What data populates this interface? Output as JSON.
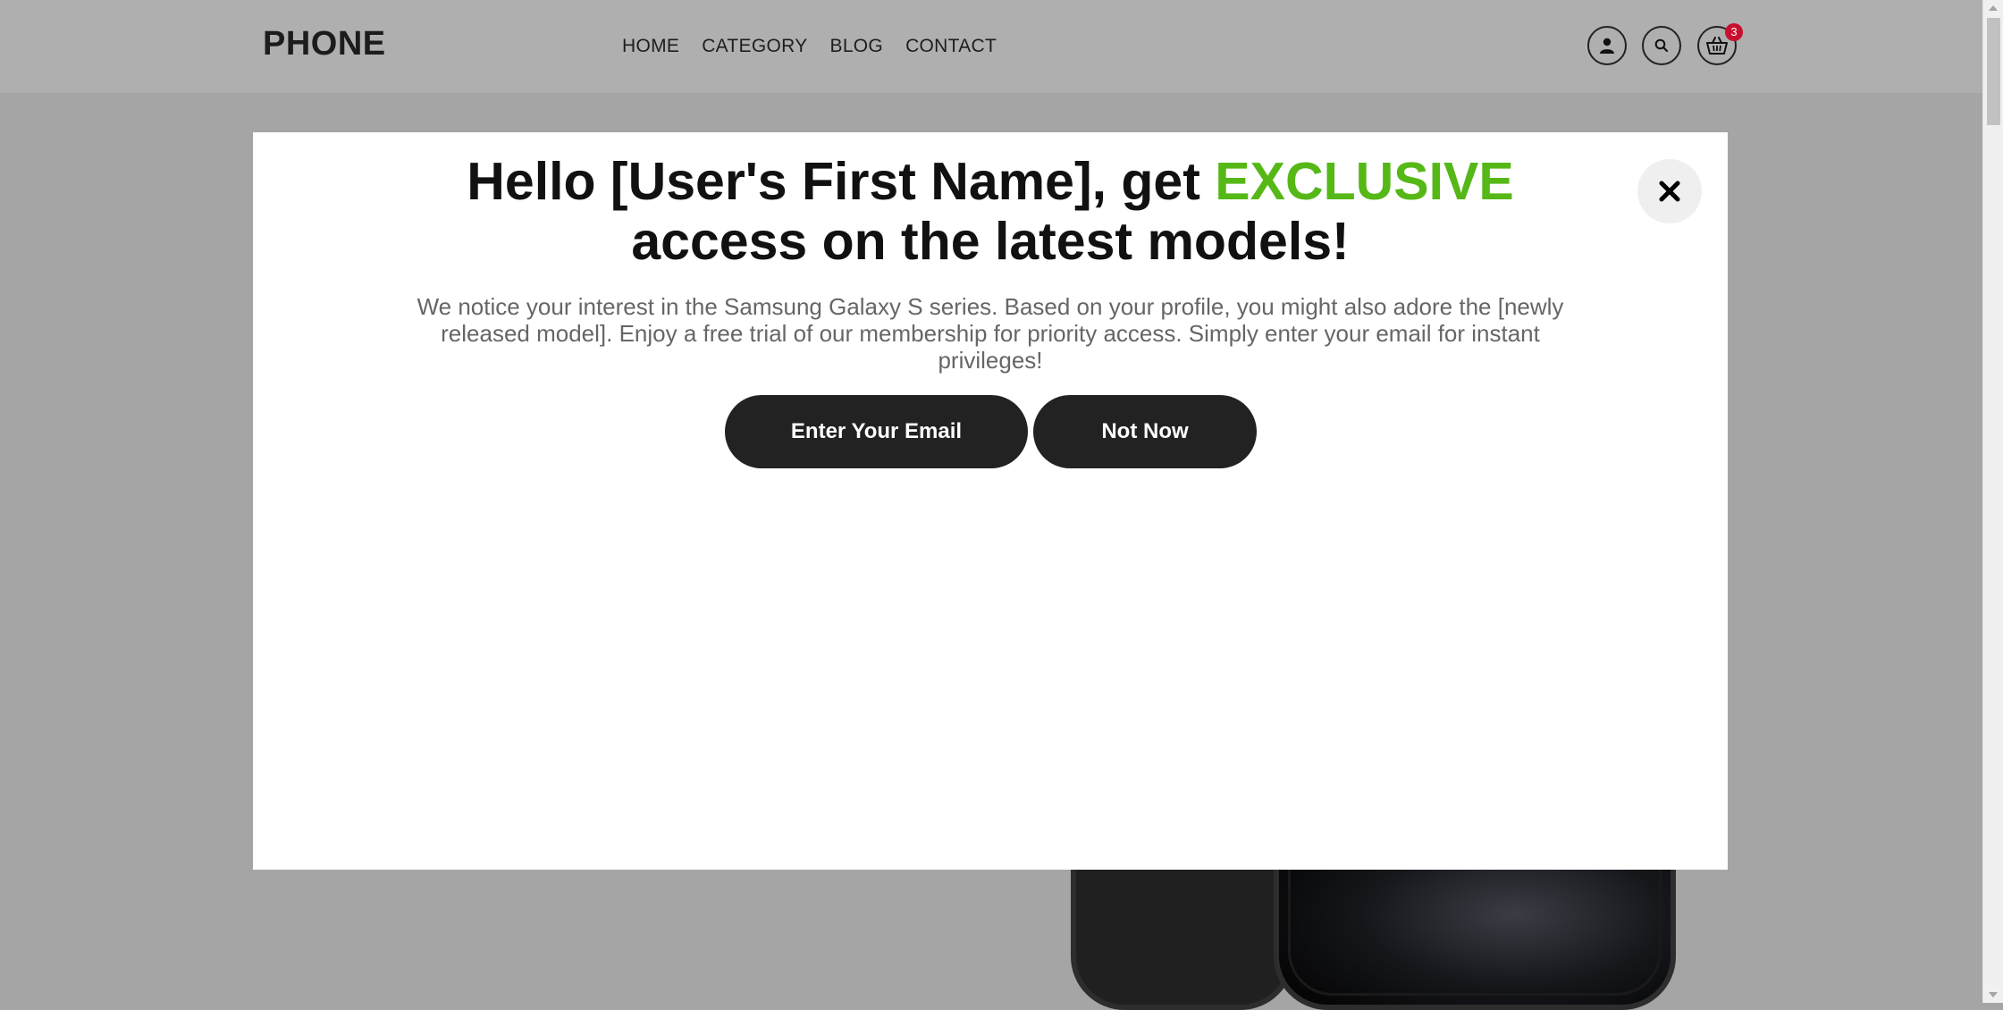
{
  "header": {
    "logo": "PHONE",
    "nav": [
      "HOME",
      "CATEGORY",
      "BLOG",
      "CONTACT"
    ],
    "icons": [
      "user-icon",
      "search-icon",
      "cart-icon"
    ],
    "cart_count": "3"
  },
  "modal": {
    "title_before": "Hello [User's First Name], get ",
    "title_highlight": "EXCLUSIVE",
    "title_after": "access on the latest models!",
    "highlight_color": "#55b816",
    "body": "We notice your interest in the Samsung Galaxy S series. Based on your profile, you might also adore the [newly released model]. Enjoy a free trial of our membership for priority access. Simply enter your email for instant privileges!",
    "primary_button": "Enter Your Email",
    "secondary_button": "Not Now",
    "close_icon": "close-icon"
  },
  "colors": {
    "overlay": "#a5a5a5",
    "header": "#afafaf",
    "button": "#222222",
    "badge": "#c8102e"
  }
}
